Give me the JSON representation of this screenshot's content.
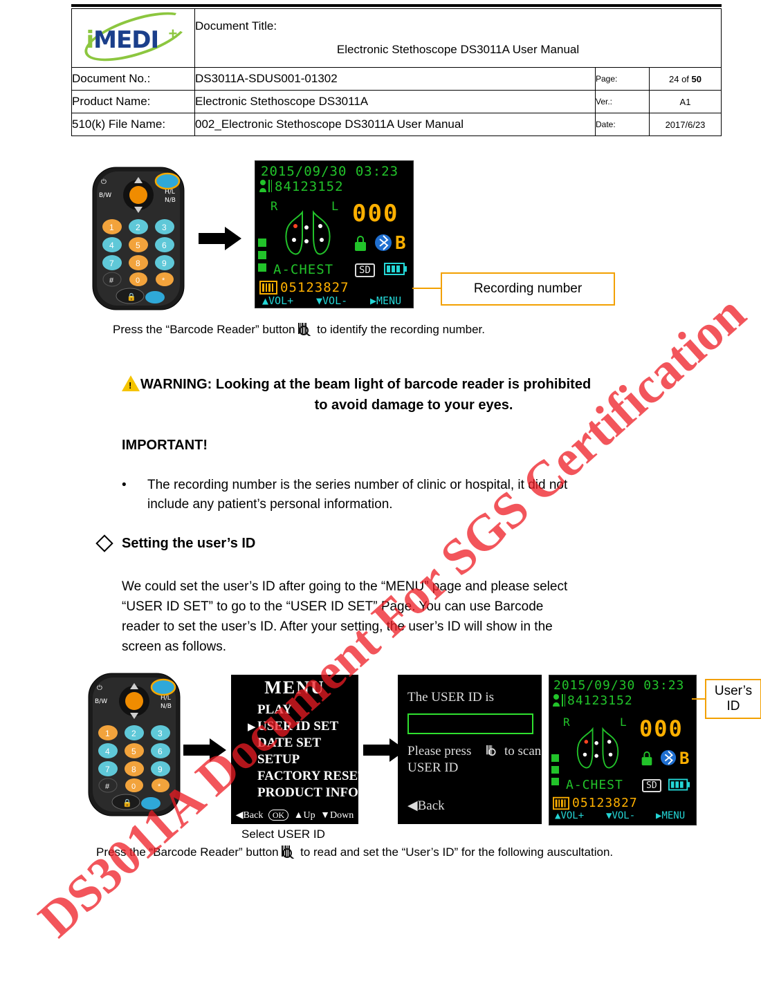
{
  "header": {
    "logo_text_i": "i",
    "logo_text_medi": "MEDI",
    "logo_plus": "+",
    "doc_title_label": "Document Title:",
    "doc_title_value": "Electronic Stethoscope DS3011A User Manual",
    "rows": [
      {
        "label": "Document No.:",
        "value": "DS3011A-SDUS001-01302"
      },
      {
        "label": "Product Name:",
        "value": "Electronic Stethoscope DS3011A"
      },
      {
        "label": "510(k) File Name:",
        "value": "002_Electronic Stethoscope DS3011A User Manual"
      }
    ],
    "page_label": "Page:",
    "page_current": "24",
    "page_of": "of",
    "page_total": "50",
    "ver_label": "Ver.:",
    "ver_value": "A1",
    "date_label": "Date:",
    "date_value": "2017/6/23"
  },
  "watermark": {
    "line1": "DS3011A Document For SGS Certification"
  },
  "figure1": {
    "callout_label": "Recording number",
    "caption_before": "Press the “Barcode Reader” button",
    "caption_after": "to identify the recording number.",
    "lcd": {
      "datetime": "2015/09/30 03:23",
      "barcode_number": "84123152",
      "left_mark": "R",
      "right_mark": "L",
      "big_value": "000",
      "mode_letter": "B",
      "channel": "A-CHEST",
      "sd_label": "SD",
      "record_id": "05123827",
      "foot_vol_up": "VOL+",
      "foot_vol_down": "VOL-",
      "foot_menu": "MENU"
    }
  },
  "warning": {
    "line1": "WARNING: Looking at the beam light of barcode reader is prohibited",
    "line2": "to avoid damage to your eyes."
  },
  "important": {
    "heading": "IMPORTANT!",
    "bullet_marker": "•",
    "bullet_line1": "The recording number is the series number of clinic or hospital, it did not",
    "bullet_line2": "include any patient’s personal information."
  },
  "section": {
    "heading": "Setting the user’s ID",
    "body_line1": "We could set the user’s ID after going to the “MENU” page and please select",
    "body_line2": "“USER ID SET” to go to the “USER ID SET” Page. You can use Barcode",
    "body_line3": "reader to set the user’s ID. After your setting, the user’s ID will show in the",
    "body_line4": "screen as follows."
  },
  "figure2": {
    "menu": {
      "title": "MENU",
      "items": [
        "PLAY",
        "USER ID SET",
        "DATE SET",
        "SETUP",
        "FACTORY RESET",
        "PRODUCT INFO"
      ],
      "footer_back": "Back",
      "footer_ok": "OK",
      "footer_up": "Up",
      "footer_down": "Down"
    },
    "userid_screen": {
      "line1": "The USER ID is",
      "line2_a": "Please press",
      "line2_b": "to scan",
      "line3": "USER ID",
      "back": "Back"
    },
    "lcd": {
      "datetime": "2015/09/30 03:23",
      "barcode_number": "84123152",
      "left_mark": "R",
      "right_mark": "L",
      "big_value": "000",
      "mode_letter": "B",
      "channel": "A-CHEST",
      "sd_label": "SD",
      "record_id": "05123827",
      "foot_vol_up": "VOL+",
      "foot_vol_down": "VOL-",
      "foot_menu": "MENU"
    },
    "callout_line1": "User’s",
    "callout_line2": "ID",
    "select_caption": "Select USER ID",
    "caption_before": "Press the “Barcode Reader” button",
    "caption_after": "to read and set the “User’s ID” for the following auscultation."
  },
  "device_keys": {
    "power": "⏻",
    "bw": "B/W",
    "hl": "H/L",
    "nb": "N/B",
    "keys": [
      "1",
      "2",
      "3",
      "4",
      "5",
      "6",
      "7",
      "8",
      "9",
      "#",
      "0",
      "*"
    ],
    "lock": "🔒",
    "barcode_label": "|||"
  }
}
